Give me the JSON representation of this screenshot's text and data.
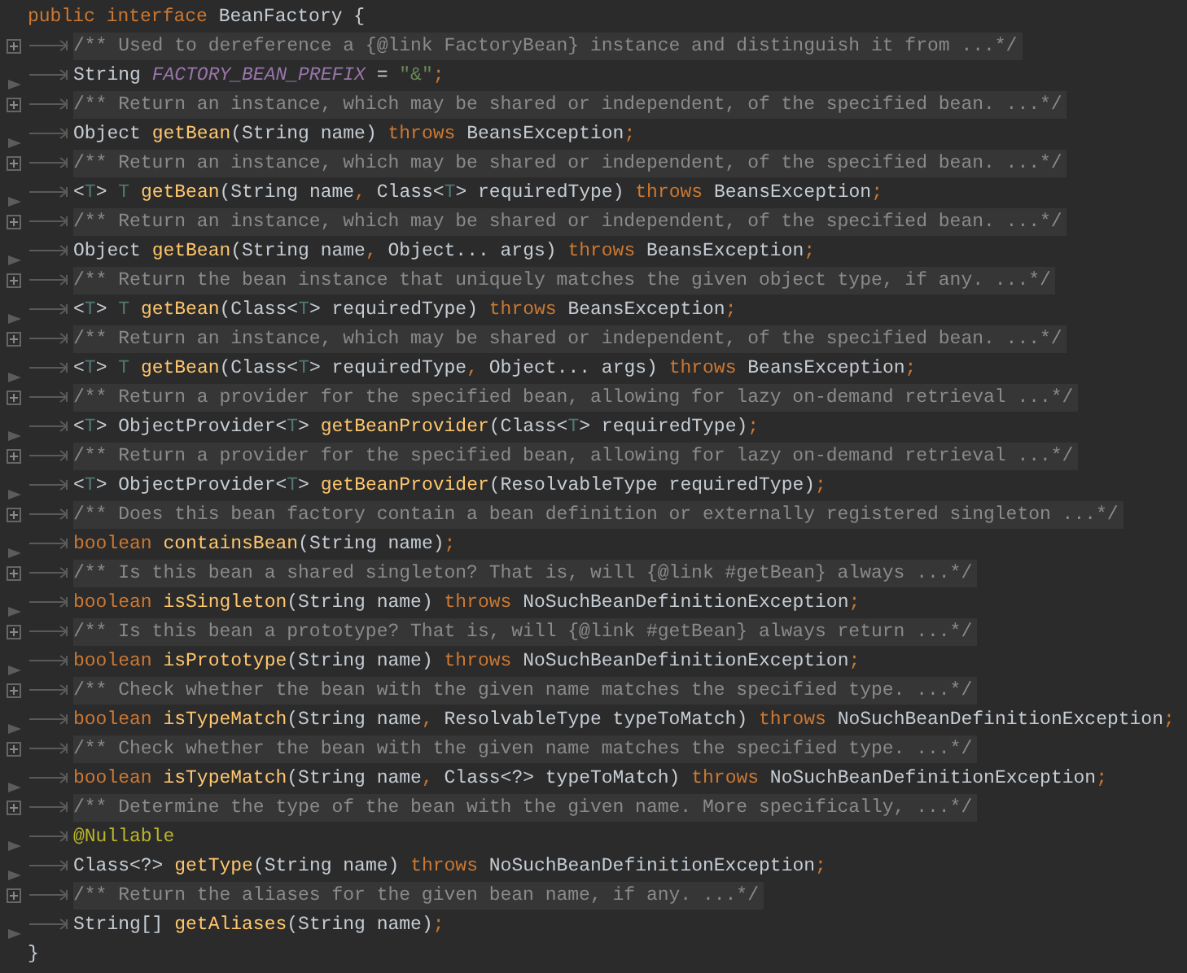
{
  "lines": [
    {
      "kind": "top",
      "tokens": [
        {
          "text": "public ",
          "kind": "keyword"
        },
        {
          "text": "interface ",
          "kind": "keyword"
        },
        {
          "text": "BeanFactory {",
          "kind": "plain"
        }
      ]
    },
    {
      "kind": "comment",
      "tokens": [
        {
          "text": "/** Used to dereference a {@link FactoryBean} instance and distinguish it from ...*/",
          "kind": "comment"
        }
      ]
    },
    {
      "kind": "code",
      "tokens": [
        {
          "text": "String ",
          "kind": "plain"
        },
        {
          "text": "FACTORY_BEAN_PREFIX",
          "kind": "constant"
        },
        {
          "text": " = ",
          "kind": "plain"
        },
        {
          "text": "\"&\"",
          "kind": "string"
        },
        {
          "text": ";",
          "kind": "keyword"
        }
      ]
    },
    {
      "kind": "comment",
      "tokens": [
        {
          "text": "/** Return an instance, which may be shared or independent, of the specified bean. ...*/",
          "kind": "comment"
        }
      ]
    },
    {
      "kind": "code",
      "tokens": [
        {
          "text": "Object ",
          "kind": "plain"
        },
        {
          "text": "getBean",
          "kind": "method"
        },
        {
          "text": "(String name) ",
          "kind": "plain"
        },
        {
          "text": "throws",
          "kind": "keyword"
        },
        {
          "text": " BeansException",
          "kind": "plain"
        },
        {
          "text": ";",
          "kind": "keyword"
        }
      ]
    },
    {
      "kind": "comment",
      "tokens": [
        {
          "text": "/** Return an instance, which may be shared or independent, of the specified bean. ...*/",
          "kind": "comment"
        }
      ]
    },
    {
      "kind": "code",
      "tokens": [
        {
          "text": "<",
          "kind": "plain"
        },
        {
          "text": "T",
          "kind": "typeparam"
        },
        {
          "text": "> ",
          "kind": "plain"
        },
        {
          "text": "T ",
          "kind": "typeparam"
        },
        {
          "text": "getBean",
          "kind": "method"
        },
        {
          "text": "(String name",
          "kind": "plain"
        },
        {
          "text": ", ",
          "kind": "keyword"
        },
        {
          "text": "Class<",
          "kind": "plain"
        },
        {
          "text": "T",
          "kind": "typeparam"
        },
        {
          "text": "> requiredType) ",
          "kind": "plain"
        },
        {
          "text": "throws",
          "kind": "keyword"
        },
        {
          "text": " BeansException",
          "kind": "plain"
        },
        {
          "text": ";",
          "kind": "keyword"
        }
      ]
    },
    {
      "kind": "comment",
      "tokens": [
        {
          "text": "/** Return an instance, which may be shared or independent, of the specified bean. ...*/",
          "kind": "comment"
        }
      ]
    },
    {
      "kind": "code",
      "tokens": [
        {
          "text": "Object ",
          "kind": "plain"
        },
        {
          "text": "getBean",
          "kind": "method"
        },
        {
          "text": "(String name",
          "kind": "plain"
        },
        {
          "text": ", ",
          "kind": "keyword"
        },
        {
          "text": "Object... args) ",
          "kind": "plain"
        },
        {
          "text": "throws",
          "kind": "keyword"
        },
        {
          "text": " BeansException",
          "kind": "plain"
        },
        {
          "text": ";",
          "kind": "keyword"
        }
      ]
    },
    {
      "kind": "comment",
      "tokens": [
        {
          "text": "/** Return the bean instance that uniquely matches the given object type, if any. ...*/",
          "kind": "comment"
        }
      ]
    },
    {
      "kind": "code",
      "tokens": [
        {
          "text": "<",
          "kind": "plain"
        },
        {
          "text": "T",
          "kind": "typeparam"
        },
        {
          "text": "> ",
          "kind": "plain"
        },
        {
          "text": "T ",
          "kind": "typeparam"
        },
        {
          "text": "getBean",
          "kind": "method"
        },
        {
          "text": "(Class<",
          "kind": "plain"
        },
        {
          "text": "T",
          "kind": "typeparam"
        },
        {
          "text": "> requiredType) ",
          "kind": "plain"
        },
        {
          "text": "throws",
          "kind": "keyword"
        },
        {
          "text": " BeansException",
          "kind": "plain"
        },
        {
          "text": ";",
          "kind": "keyword"
        }
      ]
    },
    {
      "kind": "comment",
      "tokens": [
        {
          "text": "/** Return an instance, which may be shared or independent, of the specified bean. ...*/",
          "kind": "comment"
        }
      ]
    },
    {
      "kind": "code",
      "tokens": [
        {
          "text": "<",
          "kind": "plain"
        },
        {
          "text": "T",
          "kind": "typeparam"
        },
        {
          "text": "> ",
          "kind": "plain"
        },
        {
          "text": "T ",
          "kind": "typeparam"
        },
        {
          "text": "getBean",
          "kind": "method"
        },
        {
          "text": "(Class<",
          "kind": "plain"
        },
        {
          "text": "T",
          "kind": "typeparam"
        },
        {
          "text": "> requiredType",
          "kind": "plain"
        },
        {
          "text": ", ",
          "kind": "keyword"
        },
        {
          "text": "Object... args) ",
          "kind": "plain"
        },
        {
          "text": "throws",
          "kind": "keyword"
        },
        {
          "text": " BeansException",
          "kind": "plain"
        },
        {
          "text": ";",
          "kind": "keyword"
        }
      ]
    },
    {
      "kind": "comment",
      "tokens": [
        {
          "text": "/** Return a provider for the specified bean, allowing for lazy on-demand retrieval ...*/",
          "kind": "comment"
        }
      ]
    },
    {
      "kind": "code",
      "tokens": [
        {
          "text": "<",
          "kind": "plain"
        },
        {
          "text": "T",
          "kind": "typeparam"
        },
        {
          "text": "> ObjectProvider<",
          "kind": "plain"
        },
        {
          "text": "T",
          "kind": "typeparam"
        },
        {
          "text": "> ",
          "kind": "plain"
        },
        {
          "text": "getBeanProvider",
          "kind": "method"
        },
        {
          "text": "(Class<",
          "kind": "plain"
        },
        {
          "text": "T",
          "kind": "typeparam"
        },
        {
          "text": "> requiredType)",
          "kind": "plain"
        },
        {
          "text": ";",
          "kind": "keyword"
        }
      ]
    },
    {
      "kind": "comment",
      "tokens": [
        {
          "text": "/** Return a provider for the specified bean, allowing for lazy on-demand retrieval ...*/",
          "kind": "comment"
        }
      ]
    },
    {
      "kind": "code",
      "tokens": [
        {
          "text": "<",
          "kind": "plain"
        },
        {
          "text": "T",
          "kind": "typeparam"
        },
        {
          "text": "> ObjectProvider<",
          "kind": "plain"
        },
        {
          "text": "T",
          "kind": "typeparam"
        },
        {
          "text": "> ",
          "kind": "plain"
        },
        {
          "text": "getBeanProvider",
          "kind": "method"
        },
        {
          "text": "(ResolvableType requiredType)",
          "kind": "plain"
        },
        {
          "text": ";",
          "kind": "keyword"
        }
      ]
    },
    {
      "kind": "comment",
      "tokens": [
        {
          "text": "/** Does this bean factory contain a bean definition or externally registered singleton ...*/",
          "kind": "comment"
        }
      ]
    },
    {
      "kind": "code",
      "tokens": [
        {
          "text": "boolean ",
          "kind": "keyword"
        },
        {
          "text": "containsBean",
          "kind": "method"
        },
        {
          "text": "(String name)",
          "kind": "plain"
        },
        {
          "text": ";",
          "kind": "keyword"
        }
      ]
    },
    {
      "kind": "comment",
      "tokens": [
        {
          "text": "/** Is this bean a shared singleton? That is, will {@link #getBean} always ...*/",
          "kind": "comment"
        }
      ]
    },
    {
      "kind": "code",
      "tokens": [
        {
          "text": "boolean ",
          "kind": "keyword"
        },
        {
          "text": "isSingleton",
          "kind": "method"
        },
        {
          "text": "(String name) ",
          "kind": "plain"
        },
        {
          "text": "throws",
          "kind": "keyword"
        },
        {
          "text": " NoSuchBeanDefinitionException",
          "kind": "plain"
        },
        {
          "text": ";",
          "kind": "keyword"
        }
      ]
    },
    {
      "kind": "comment",
      "tokens": [
        {
          "text": "/** Is this bean a prototype? That is, will {@link #getBean} always return ...*/",
          "kind": "comment"
        }
      ]
    },
    {
      "kind": "code",
      "tokens": [
        {
          "text": "boolean ",
          "kind": "keyword"
        },
        {
          "text": "isPrototype",
          "kind": "method"
        },
        {
          "text": "(String name) ",
          "kind": "plain"
        },
        {
          "text": "throws",
          "kind": "keyword"
        },
        {
          "text": " NoSuchBeanDefinitionException",
          "kind": "plain"
        },
        {
          "text": ";",
          "kind": "keyword"
        }
      ]
    },
    {
      "kind": "comment",
      "tokens": [
        {
          "text": "/** Check whether the bean with the given name matches the specified type. ...*/",
          "kind": "comment"
        }
      ]
    },
    {
      "kind": "code",
      "tokens": [
        {
          "text": "boolean ",
          "kind": "keyword"
        },
        {
          "text": "isTypeMatch",
          "kind": "method"
        },
        {
          "text": "(String name",
          "kind": "plain"
        },
        {
          "text": ", ",
          "kind": "keyword"
        },
        {
          "text": "ResolvableType typeToMatch) ",
          "kind": "plain"
        },
        {
          "text": "throws",
          "kind": "keyword"
        },
        {
          "text": " NoSuchBeanDefinitionException",
          "kind": "plain"
        },
        {
          "text": ";",
          "kind": "keyword"
        }
      ]
    },
    {
      "kind": "comment",
      "tokens": [
        {
          "text": "/** Check whether the bean with the given name matches the specified type. ...*/",
          "kind": "comment"
        }
      ]
    },
    {
      "kind": "code",
      "tokens": [
        {
          "text": "boolean ",
          "kind": "keyword"
        },
        {
          "text": "isTypeMatch",
          "kind": "method"
        },
        {
          "text": "(String name",
          "kind": "plain"
        },
        {
          "text": ", ",
          "kind": "keyword"
        },
        {
          "text": "Class<?> typeToMatch) ",
          "kind": "plain"
        },
        {
          "text": "throws",
          "kind": "keyword"
        },
        {
          "text": " NoSuchBeanDefinitionException",
          "kind": "plain"
        },
        {
          "text": ";",
          "kind": "keyword"
        }
      ]
    },
    {
      "kind": "comment",
      "tokens": [
        {
          "text": "/** Determine the type of the bean with the given name. More specifically, ...*/",
          "kind": "comment"
        }
      ]
    },
    {
      "kind": "code",
      "tokens": [
        {
          "text": "@Nullable",
          "kind": "annotation"
        }
      ]
    },
    {
      "kind": "code",
      "tokens": [
        {
          "text": "Class<?> ",
          "kind": "plain"
        },
        {
          "text": "getType",
          "kind": "method"
        },
        {
          "text": "(String name) ",
          "kind": "plain"
        },
        {
          "text": "throws",
          "kind": "keyword"
        },
        {
          "text": " NoSuchBeanDefinitionException",
          "kind": "plain"
        },
        {
          "text": ";",
          "kind": "keyword"
        }
      ]
    },
    {
      "kind": "comment",
      "tokens": [
        {
          "text": "/** Return the aliases for the given bean name, if any. ...*/",
          "kind": "comment"
        }
      ]
    },
    {
      "kind": "code",
      "tokens": [
        {
          "text": "String[] ",
          "kind": "plain"
        },
        {
          "text": "getAliases",
          "kind": "method"
        },
        {
          "text": "(String name)",
          "kind": "plain"
        },
        {
          "text": ";",
          "kind": "keyword"
        }
      ]
    },
    {
      "kind": "top",
      "tokens": [
        {
          "text": "}",
          "kind": "plain"
        }
      ]
    }
  ]
}
